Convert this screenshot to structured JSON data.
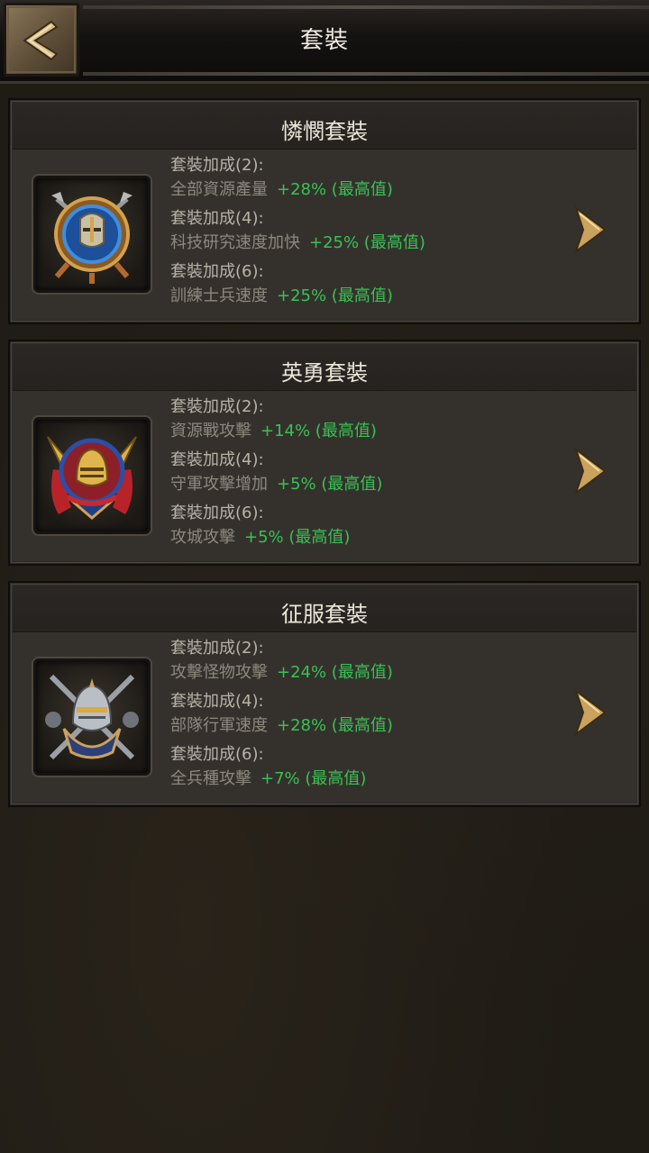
{
  "header": {
    "title": "套裝",
    "back_icon": "back-arrow-icon"
  },
  "colors": {
    "bonus_value_green": "#39c154",
    "gold_accent": "#c9a25f"
  },
  "sets": [
    {
      "name": "憐憫套裝",
      "icon": "blue-shield-helmet-icon",
      "bonuses": [
        {
          "label": "套裝加成(2):",
          "stat": "全部資源產量",
          "value": "+28% (最高值)"
        },
        {
          "label": "套裝加成(4):",
          "stat": "科技研究速度加快",
          "value": "+25% (最高值)"
        },
        {
          "label": "套裝加成(6):",
          "stat": "訓練士兵速度",
          "value": "+25% (最高值)"
        }
      ]
    },
    {
      "name": "英勇套裝",
      "icon": "trumpet-knight-helmet-icon",
      "bonuses": [
        {
          "label": "套裝加成(2):",
          "stat": "資源戰攻擊",
          "value": "+14% (最高值)"
        },
        {
          "label": "套裝加成(4):",
          "stat": "守軍攻擊增加",
          "value": "+5% (最高值)"
        },
        {
          "label": "套裝加成(6):",
          "stat": "攻城攻擊",
          "value": "+5% (最高值)"
        }
      ]
    },
    {
      "name": "征服套裝",
      "icon": "crossed-weapons-helmet-icon",
      "bonuses": [
        {
          "label": "套裝加成(2):",
          "stat": "攻擊怪物攻擊",
          "value": "+24% (最高值)"
        },
        {
          "label": "套裝加成(4):",
          "stat": "部隊行軍速度",
          "value": "+28% (最高值)"
        },
        {
          "label": "套裝加成(6):",
          "stat": "全兵種攻擊",
          "value": "+7% (最高值)"
        }
      ]
    }
  ]
}
